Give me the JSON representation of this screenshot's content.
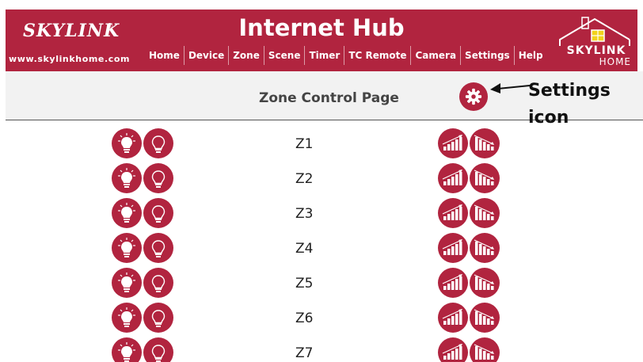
{
  "header": {
    "logo_text": "SKYLINK",
    "logo_mark": "®",
    "logo_url": "www.skylinkhome.com",
    "title": "Internet Hub",
    "brand_line1": "SKYLINK",
    "brand_line2": "HOME",
    "nav": [
      "Home",
      "Device",
      "Zone",
      "Scene",
      "Timer",
      "TC Remote",
      "Camera",
      "Settings",
      "Help"
    ]
  },
  "page": {
    "title": "Zone Control Page",
    "settings_icon": "gear-icon"
  },
  "annotation": {
    "line1": "Settings",
    "line2": "icon"
  },
  "zones": [
    "Z1",
    "Z2",
    "Z3",
    "Z4",
    "Z5",
    "Z6",
    "Z7"
  ],
  "icons": {
    "light_on": "bulb-on-icon",
    "light_off": "bulb-off-icon",
    "dim_up": "brightness-up-icon",
    "dim_down": "brightness-down-icon"
  },
  "colors": {
    "accent": "#b1243f",
    "subheader_bg": "#f2f2f2"
  }
}
